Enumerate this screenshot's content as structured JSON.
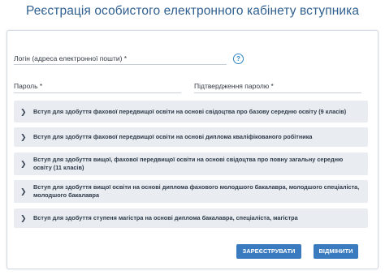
{
  "page": {
    "title": "Реєстрація особистого електронного кабінету вступника"
  },
  "form": {
    "login_label": "Логін (адреса електронної пошти) *",
    "help_icon_glyph": "?",
    "password_label": "Пароль *",
    "confirm_password_label": "Підтвердження паролю *"
  },
  "admission_options": [
    {
      "label": "Вступ для здобуття фахової передвищої освіти на основі свідоцтва про базову середню освіту (9 класів)",
      "icon": "chevron-right-icon"
    },
    {
      "label": "Вступ для здобуття фахової передвищої освіти на основі диплома кваліфікованого робітника",
      "icon": "chevron-right-icon"
    },
    {
      "label": "Вступ для здобуття вищої, фахової передвищої освіти на основі свідоцтва про повну загальну середню освіту (11 класів)",
      "icon": "chevron-right-icon"
    },
    {
      "label": "Вступ для здобуття вищої освіти на основі диплома фахового молодшого бакалавра, молодшого спеціаліста, молодшого бакалавра",
      "icon": "chevron-right-icon"
    },
    {
      "label": "Вступ для здобуття ступеня магістра на основі диплома бакалавра, спеціаліста, магістра",
      "icon": "chevron-right-icon"
    }
  ],
  "actions": {
    "register_label": "ЗАРЕЄСТРУВАТИ",
    "cancel_label": "ВІДМІНИТИ"
  },
  "colors": {
    "title": "#2f5f8f",
    "accordion_bg": "#e9edf2",
    "button_bg": "#3a7bbf",
    "help_icon": "#2f86c8"
  }
}
